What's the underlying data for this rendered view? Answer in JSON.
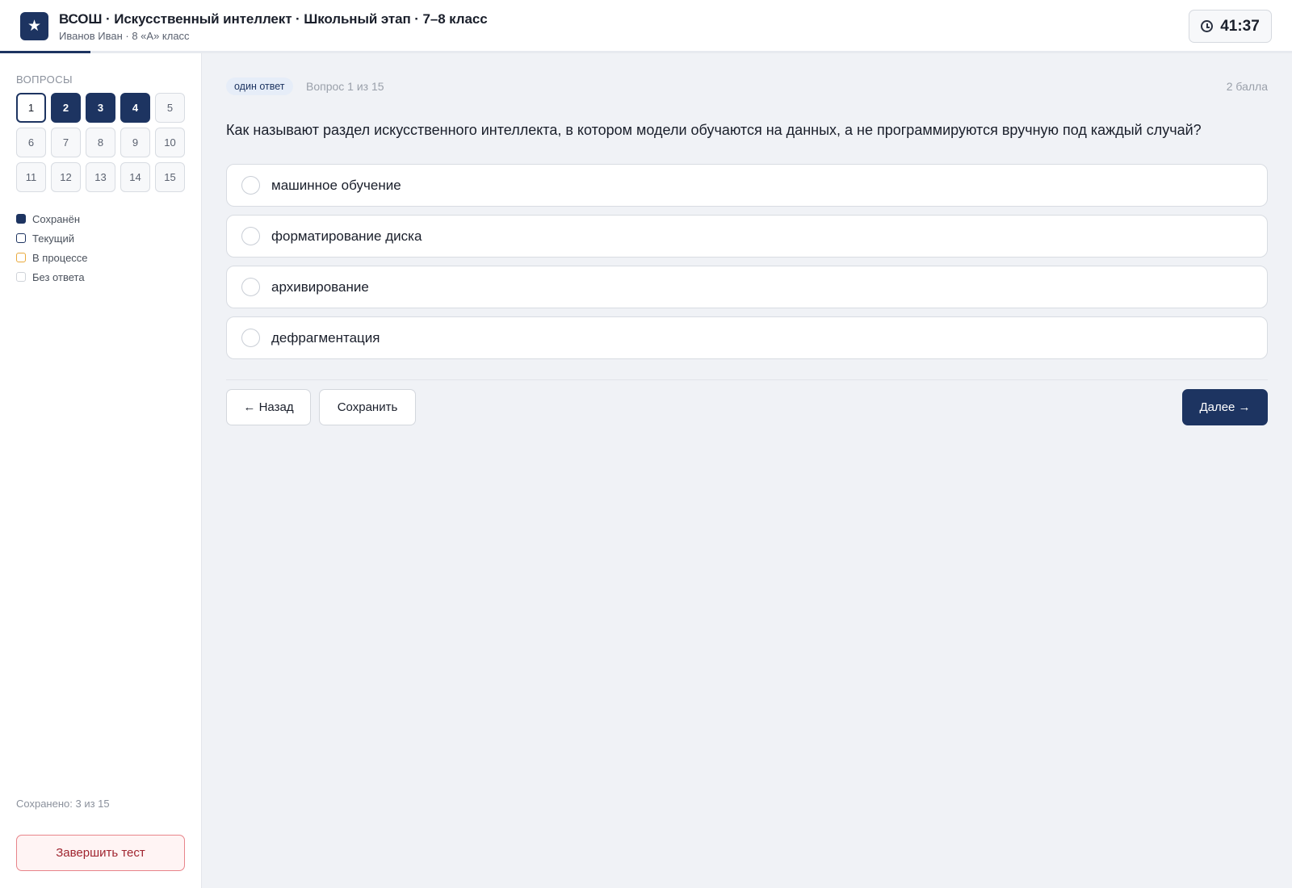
{
  "header": {
    "logo_glyph": "★",
    "title": "ВСОШ · Искусственный интеллект · Школьный этап · 7–8 класс",
    "subtitle": "Иванов Иван · 8 «А» класс",
    "timer": "41:37",
    "progress_fraction": 0.07
  },
  "sidebar": {
    "heading": "ВОПРОСЫ",
    "questions": [
      {
        "n": "1",
        "state": "current"
      },
      {
        "n": "2",
        "state": "saved"
      },
      {
        "n": "3",
        "state": "saved"
      },
      {
        "n": "4",
        "state": "saved"
      },
      {
        "n": "5",
        "state": "none"
      },
      {
        "n": "6",
        "state": "none"
      },
      {
        "n": "7",
        "state": "none"
      },
      {
        "n": "8",
        "state": "none"
      },
      {
        "n": "9",
        "state": "none"
      },
      {
        "n": "10",
        "state": "none"
      },
      {
        "n": "11",
        "state": "none"
      },
      {
        "n": "12",
        "state": "none"
      },
      {
        "n": "13",
        "state": "none"
      },
      {
        "n": "14",
        "state": "none"
      },
      {
        "n": "15",
        "state": "none"
      }
    ],
    "legend": [
      {
        "key": "saved",
        "label": "Сохранён"
      },
      {
        "key": "current",
        "label": "Текущий"
      },
      {
        "key": "progress",
        "label": "В процессе"
      },
      {
        "key": "none",
        "label": "Без ответа"
      }
    ],
    "saved_count": "Сохранено: 3 из 15",
    "finish_label": "Завершить тест"
  },
  "main": {
    "type_badge": "один ответ",
    "counter": "Вопрос 1 из 15",
    "points": "2 балла",
    "question": "Как называют раздел искусственного интеллекта, в котором модели обучаются на данных, а не программируются вручную под каждый случай?",
    "options": [
      "машинное обучение",
      "форматирование диска",
      "архивирование",
      "дефрагментация"
    ],
    "back_label": "← Назад",
    "save_label": "Сохранить",
    "next_label": "Далее →"
  },
  "colors": {
    "accent": "#1d3461",
    "in_progress": "#e9a93b",
    "danger": "#a02530"
  }
}
